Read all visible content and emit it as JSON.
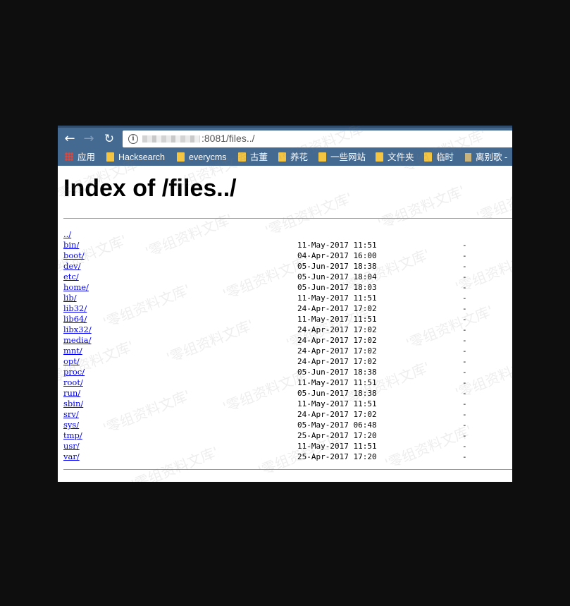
{
  "browser": {
    "back_icon": "arrow-left-icon",
    "forward_icon": "arrow-right-icon",
    "reload_icon": "reload-icon",
    "info_icon": "info-icon",
    "address": ":8081/files../",
    "bookmarks": [
      {
        "label": "应用",
        "icon": "apps-grid-icon"
      },
      {
        "label": "Hacksearch",
        "icon": "folder-icon"
      },
      {
        "label": "everycms",
        "icon": "folder-icon"
      },
      {
        "label": "古董",
        "icon": "folder-icon"
      },
      {
        "label": "养花",
        "icon": "folder-icon"
      },
      {
        "label": "一些网站",
        "icon": "folder-icon"
      },
      {
        "label": "文件夹",
        "icon": "folder-icon"
      },
      {
        "label": "临时",
        "icon": "folder-icon"
      },
      {
        "label": "离别歌 -",
        "icon": "page-icon"
      }
    ]
  },
  "page": {
    "title": "Index of /files../",
    "parent_link": "../",
    "entries": [
      {
        "name": "bin/",
        "date": "11-May-2017 11:51",
        "size": "-"
      },
      {
        "name": "boot/",
        "date": "04-Apr-2017 16:00",
        "size": "-"
      },
      {
        "name": "dev/",
        "date": "05-Jun-2017 18:38",
        "size": "-"
      },
      {
        "name": "etc/",
        "date": "05-Jun-2017 18:04",
        "size": "-"
      },
      {
        "name": "home/",
        "date": "05-Jun-2017 18:03",
        "size": "-"
      },
      {
        "name": "lib/",
        "date": "11-May-2017 11:51",
        "size": "-"
      },
      {
        "name": "lib32/",
        "date": "24-Apr-2017 17:02",
        "size": "-"
      },
      {
        "name": "lib64/",
        "date": "11-May-2017 11:51",
        "size": "-"
      },
      {
        "name": "libx32/",
        "date": "24-Apr-2017 17:02",
        "size": "-"
      },
      {
        "name": "media/",
        "date": "24-Apr-2017 17:02",
        "size": "-"
      },
      {
        "name": "mnt/",
        "date": "24-Apr-2017 17:02",
        "size": "-"
      },
      {
        "name": "opt/",
        "date": "24-Apr-2017 17:02",
        "size": "-"
      },
      {
        "name": "proc/",
        "date": "05-Jun-2017 18:38",
        "size": "-"
      },
      {
        "name": "root/",
        "date": "11-May-2017 11:51",
        "size": "-"
      },
      {
        "name": "run/",
        "date": "05-Jun-2017 18:38",
        "size": "-"
      },
      {
        "name": "sbin/",
        "date": "11-May-2017 11:51",
        "size": "-"
      },
      {
        "name": "srv/",
        "date": "24-Apr-2017 17:02",
        "size": "-"
      },
      {
        "name": "sys/",
        "date": "05-May-2017 06:48",
        "size": "-"
      },
      {
        "name": "tmp/",
        "date": "25-Apr-2017 17:20",
        "size": "-"
      },
      {
        "name": "usr/",
        "date": "11-May-2017 11:51",
        "size": "-"
      },
      {
        "name": "var/",
        "date": "25-Apr-2017 17:20",
        "size": "-"
      }
    ]
  },
  "watermark": "'零组资料文库'"
}
